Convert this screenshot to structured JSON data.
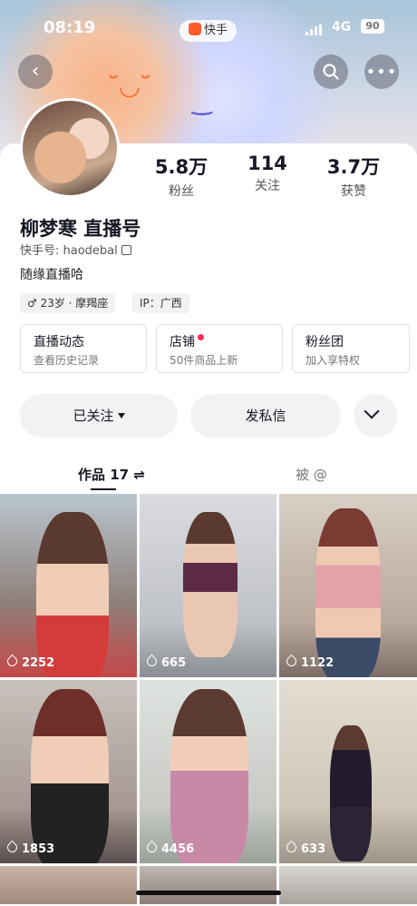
{
  "status": {
    "time": "08:19",
    "app_name": "快手",
    "network": "4G",
    "battery": "90"
  },
  "colors": {
    "accent": "#fe2c55",
    "brand": "#ff5a2c"
  },
  "header": {
    "back_icon": "back-arrow-icon",
    "search_icon": "search-icon",
    "more_icon": "more-icon"
  },
  "stats": [
    {
      "value": "5.8万",
      "label": "粉丝"
    },
    {
      "value": "114",
      "label": "关注"
    },
    {
      "value": "3.7万",
      "label": "获赞"
    }
  ],
  "profile": {
    "name": "柳梦寒 直播号",
    "kuaishou_id": "快手号: haodebal",
    "bio": "随缘直播哈",
    "tags": [
      "♂ 23岁 · 摩羯座",
      "IP：广西"
    ]
  },
  "cards": [
    {
      "title": "直播动态",
      "subtitle": "查看历史记录"
    },
    {
      "title": "店铺",
      "subtitle": "50件商品上新"
    },
    {
      "title": "粉丝团",
      "subtitle": "加入享特权"
    }
  ],
  "actions": {
    "follow": "已关注",
    "message": "发私信"
  },
  "tabs": {
    "works": "作品 17 ⇌",
    "mentioned": "被 @"
  },
  "posts": [
    {
      "likes": "2252"
    },
    {
      "likes": "665"
    },
    {
      "likes": "1122"
    },
    {
      "likes": "1853"
    },
    {
      "likes": "4456"
    },
    {
      "likes": "633"
    }
  ]
}
